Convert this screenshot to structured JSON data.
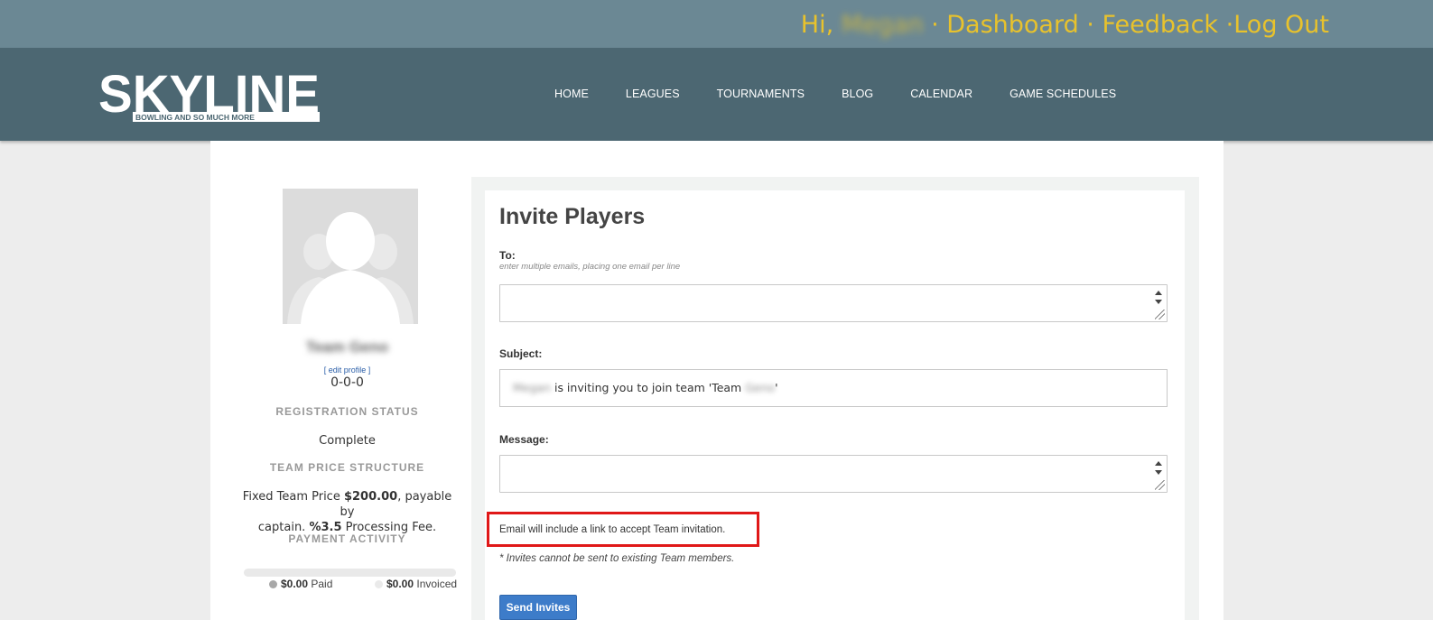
{
  "userbar": {
    "greeting": "Hi,",
    "user_name": "Megan",
    "sep1": " · ",
    "dashboard": "Dashboard",
    "sep2": " · ",
    "feedback": "Feedback",
    "sep3": " ·",
    "logout": "Log Out"
  },
  "logo": {
    "wordmark": "SKYLINE",
    "tagline": "BOWLING AND SO MUCH MORE"
  },
  "nav": {
    "items": [
      "HOME",
      "LEAGUES",
      "TOURNAMENTS",
      "BLOG",
      "CALENDAR",
      "GAME SCHEDULES"
    ]
  },
  "sidebar": {
    "team_name": "Team Geno",
    "edit_profile": "[ edit profile ]",
    "record": "0-0-0",
    "registration_label": "REGISTRATION STATUS",
    "registration_value": "Complete",
    "price_label": "TEAM PRICE STRUCTURE",
    "price_line1_pre": "Fixed Team Price ",
    "price_amount": "$200.00",
    "price_line1_post": ", payable by",
    "price_line2_pre": "captain. ",
    "fee_amount": "%3.5",
    "price_line2_post": " Processing Fee.",
    "payment_label": "PAYMENT ACTIVITY",
    "paid_amount": "$0.00",
    "paid_label": " Paid",
    "invoiced_amount": "$0.00",
    "invoiced_label": " Invoiced",
    "paid_fraction": 0
  },
  "form": {
    "title": "Invite Players",
    "to_label": "To:",
    "to_hint": "enter multiple emails, placing one email per line",
    "to_value": "",
    "subject_label": "Subject:",
    "subject_name": "Megan",
    "subject_middle": " is inviting you to join team 'Team ",
    "subject_team": "Geno",
    "subject_end": "'",
    "message_label": "Message:",
    "message_value": "",
    "note": "Email will include a link to accept Team invitation.",
    "note_italic": "* Invites cannot be sent to existing Team members.",
    "send_button": "Send Invites"
  },
  "colors": {
    "userbar_bg": "#6b8894",
    "navbar_bg": "#4c6772",
    "link_yellow": "#e8c22c",
    "button_blue": "#3d7cc9",
    "highlight_red": "#e01818"
  }
}
